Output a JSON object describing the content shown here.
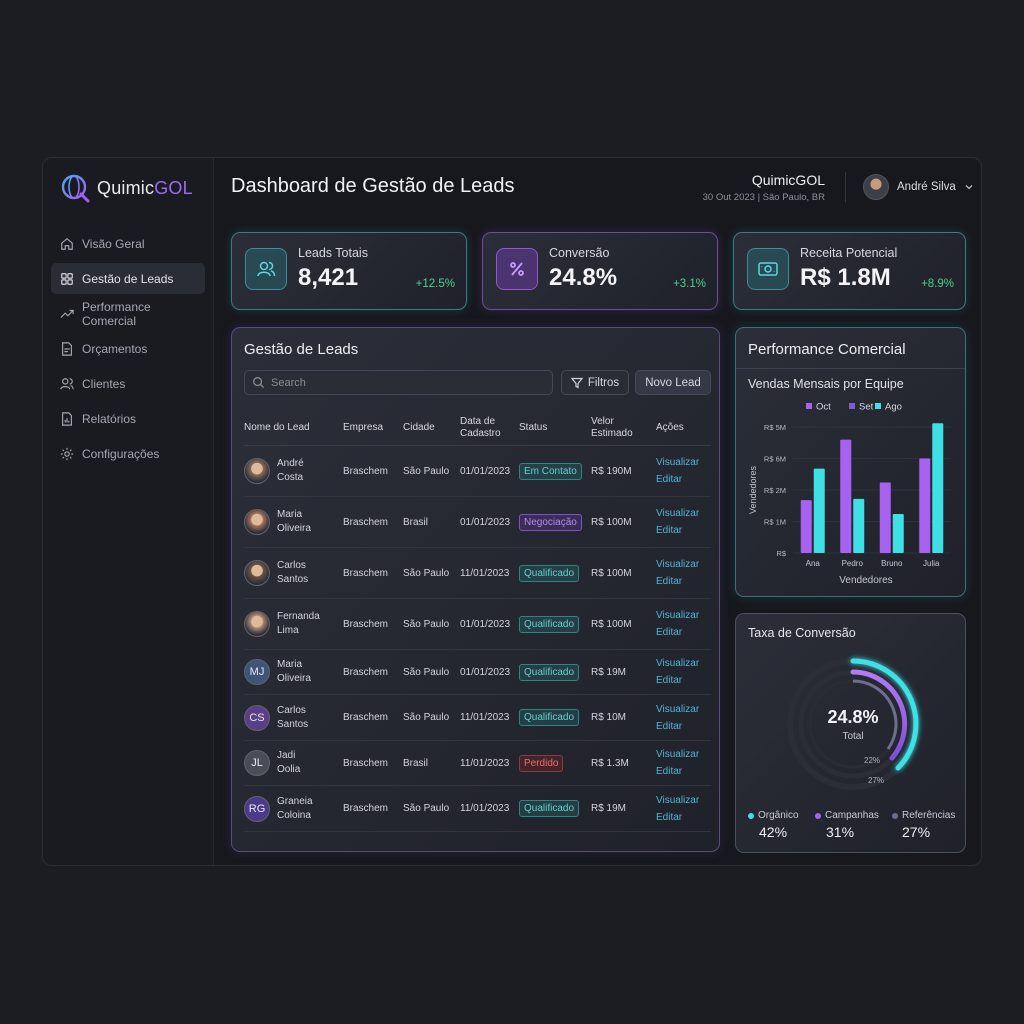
{
  "app": {
    "logo_prefix": "Quimic",
    "logo_suffix": "GOL",
    "brand_color": "#9b6cf2",
    "accent_teal": "#3ee0e4"
  },
  "sidebar": {
    "items": [
      {
        "label": "Visão Geral",
        "icon": "home-icon",
        "active": false
      },
      {
        "label": "Gestão de Leads",
        "icon": "grid-icon",
        "active": true
      },
      {
        "label": "Performance Comercial",
        "icon": "trend-icon",
        "active": false
      },
      {
        "label": "Orçamentos",
        "icon": "document-icon",
        "active": false
      },
      {
        "label": "Clientes",
        "icon": "users-icon",
        "active": false
      },
      {
        "label": "Relatórios",
        "icon": "report-icon",
        "active": false
      },
      {
        "label": "Configurações",
        "icon": "gear-icon",
        "active": false
      }
    ]
  },
  "header": {
    "title": "Dashboard de Gestão de Leads",
    "company": "QuimicGOL",
    "meta": "30 Out 2023 | São Paulo, BR",
    "user_name": "André Silva"
  },
  "kpis": [
    {
      "label": "Leads Totais",
      "value": "8,421",
      "delta": "+12.5%",
      "icon": "users-icon"
    },
    {
      "label": "Conversão",
      "value": "24.8%",
      "delta": "+3.1%",
      "icon": "percent-icon"
    },
    {
      "label": "Receita Potencial",
      "value": "R$ 1.8M",
      "delta": "+8.9%",
      "icon": "money-icon"
    }
  ],
  "leads": {
    "title": "Gestão de Leads",
    "search_placeholder": "Search",
    "filter_label": "Filtros",
    "new_label": "Novo Lead",
    "columns": {
      "name": "Nome do Lead",
      "company": "Empresa",
      "city": "Cidade",
      "date_1": "Data de",
      "date_2": "Cadastro",
      "status": "Status",
      "value_1": "Velor",
      "value_2": "Estimado",
      "actions": "Ações"
    },
    "view_label": "Visualizar",
    "edit_label": "Editar",
    "rows": [
      {
        "first": "André",
        "last": "Costa",
        "initials": "",
        "company": "Braschem",
        "city": "São Paulo",
        "date": "01/01/2023",
        "status": "Em Contato",
        "status_kind": "teal",
        "value": "R$ 190M"
      },
      {
        "first": "Maria",
        "last": "Oliveira",
        "initials": "",
        "company": "Braschem",
        "city": "Brasil",
        "date": "01/01/2023",
        "status": "Negociação",
        "status_kind": "purple",
        "value": "R$ 100M"
      },
      {
        "first": "Carlos",
        "last": "Santos",
        "initials": "",
        "company": "Braschem",
        "city": "São Paulo",
        "date": "11/01/2023",
        "status": "Qualificado",
        "status_kind": "teal",
        "value": "R$ 100M"
      },
      {
        "first": "Fernanda",
        "last": "Lima",
        "initials": "",
        "company": "Braschem",
        "city": "São Paulo",
        "date": "01/01/2023",
        "status": "Qualificado",
        "status_kind": "teal",
        "value": "R$ 100M"
      },
      {
        "first": "Maria",
        "last": "Oliveira",
        "initials": "MJ",
        "company": "Braschem",
        "city": "São Paulo",
        "date": "01/01/2023",
        "status": "Qualificado",
        "status_kind": "teal",
        "value": "R$ 19M"
      },
      {
        "first": "Carlos",
        "last": "Santos",
        "initials": "CS",
        "company": "Braschem",
        "city": "São Paulo",
        "date": "11/01/2023",
        "status": "Qualificado",
        "status_kind": "teal",
        "value": "R$ 10M"
      },
      {
        "first": "Jadi",
        "last": "Oolia",
        "initials": "JL",
        "company": "Braschem",
        "city": "Brasil",
        "date": "11/01/2023",
        "status": "Perdido",
        "status_kind": "red",
        "value": "R$ 1.3M"
      },
      {
        "first": "Graneia",
        "last": "Coloina",
        "initials": "RG",
        "company": "Braschem",
        "city": "São Paulo",
        "date": "11/01/2023",
        "status": "Qualificado",
        "status_kind": "teal",
        "value": "R$ 19M"
      }
    ]
  },
  "performance": {
    "title": "Performance Comercial",
    "subtitle": "Vendas Mensais por Equipe"
  },
  "chart_data": {
    "type": "bar",
    "title": "Vendas Mensais por Equipe",
    "xlabel": "Vendedores",
    "ylabel": "Vendedores",
    "categories": [
      "Ana",
      "Pedro",
      "Bruno",
      "Julia"
    ],
    "y_ticks": [
      "R$ 5M",
      "R$ 6M",
      "R$ 2M",
      "R$ 1M",
      "R$"
    ],
    "ylim": [
      0,
      10
    ],
    "legend_position": "top",
    "series": [
      {
        "name": "Oct",
        "color": "#a763f0",
        "values": [
          4.2,
          9.0,
          5.6,
          7.5
        ]
      },
      {
        "name": "Set",
        "color": "#7e5ad8",
        "values": [
          0,
          0,
          0,
          0
        ]
      },
      {
        "name": "Ago",
        "color": "#3ee0e4",
        "values": [
          6.7,
          4.3,
          3.1,
          10.3
        ]
      }
    ]
  },
  "conversion": {
    "title": "Taxa de Conversão",
    "value": "24.8%",
    "total_label": "Total",
    "ring_label_a": "22%",
    "ring_label_b": "27%",
    "legend": [
      {
        "label": "Orgânico",
        "pct": "42%",
        "color": "#3ee0e4"
      },
      {
        "label": "Campanhas",
        "pct": "31%",
        "color": "#a763f0"
      },
      {
        "label": "Referências",
        "pct": "27%",
        "color": "#6d6f8e"
      }
    ]
  }
}
